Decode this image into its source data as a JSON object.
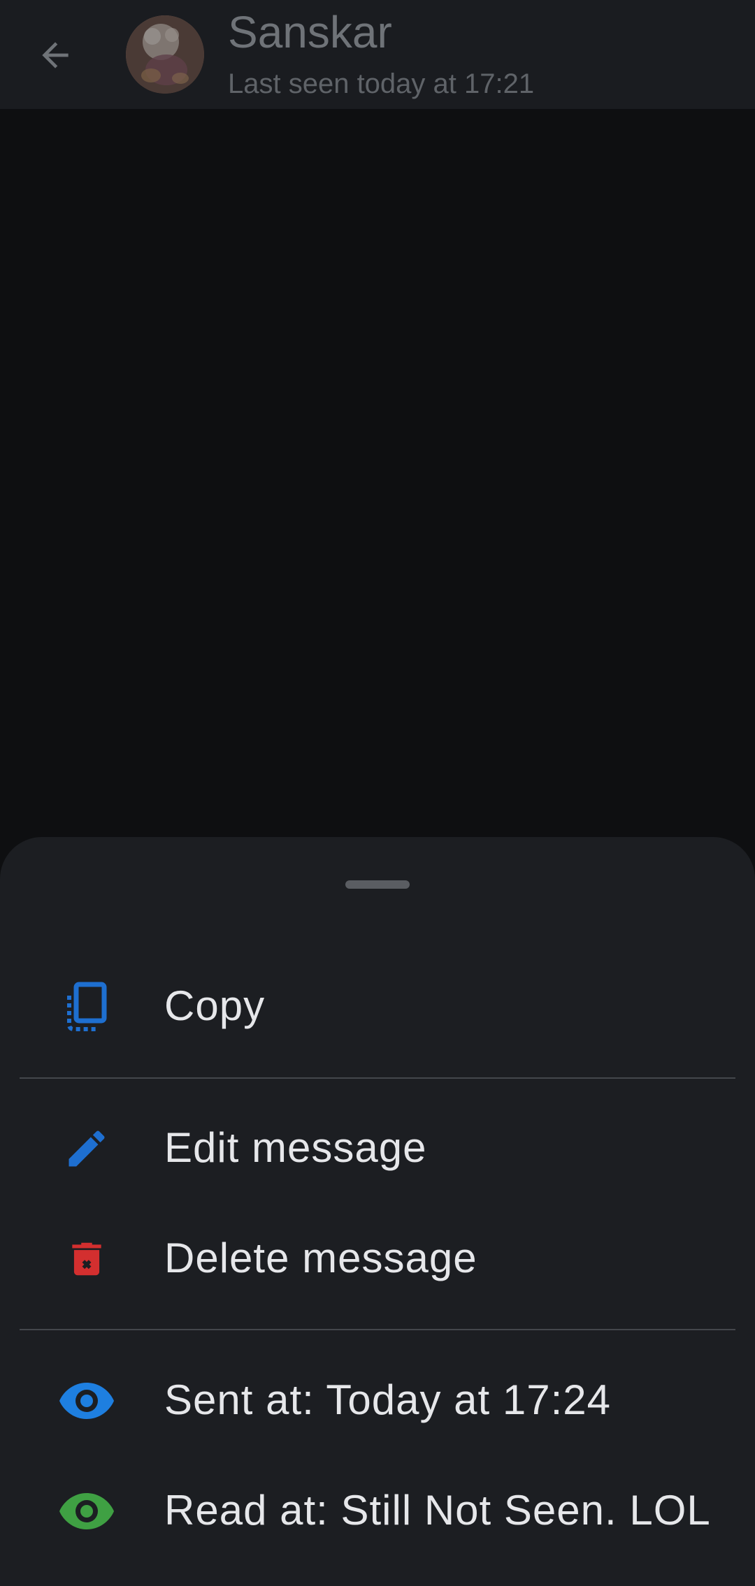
{
  "header": {
    "contact_name": "Sanskar",
    "status": "Last seen today at 17:21",
    "back_icon": "arrow-left-icon",
    "avatar": "contact-avatar"
  },
  "sheet": {
    "items": [
      {
        "label": "Copy",
        "icon": "copy-icon",
        "icon_color": "#1e6fd0"
      },
      {
        "label": "Edit message",
        "icon": "pencil-icon",
        "icon_color": "#1e6fd0"
      },
      {
        "label": "Delete message",
        "icon": "trash-icon",
        "icon_color": "#d32f2f"
      },
      {
        "label": "Sent at: Today at 17:24",
        "icon": "eye-icon",
        "icon_color": "#1e7fe0"
      },
      {
        "label": "Read at: Still Not Seen. LOL",
        "icon": "eye-icon",
        "icon_color": "#3fa043"
      }
    ]
  },
  "colors": {
    "header_bg": "#1a1c20",
    "chat_bg": "#0e0f11",
    "sheet_bg": "#1c1e22",
    "text": "#e6e7ea"
  }
}
